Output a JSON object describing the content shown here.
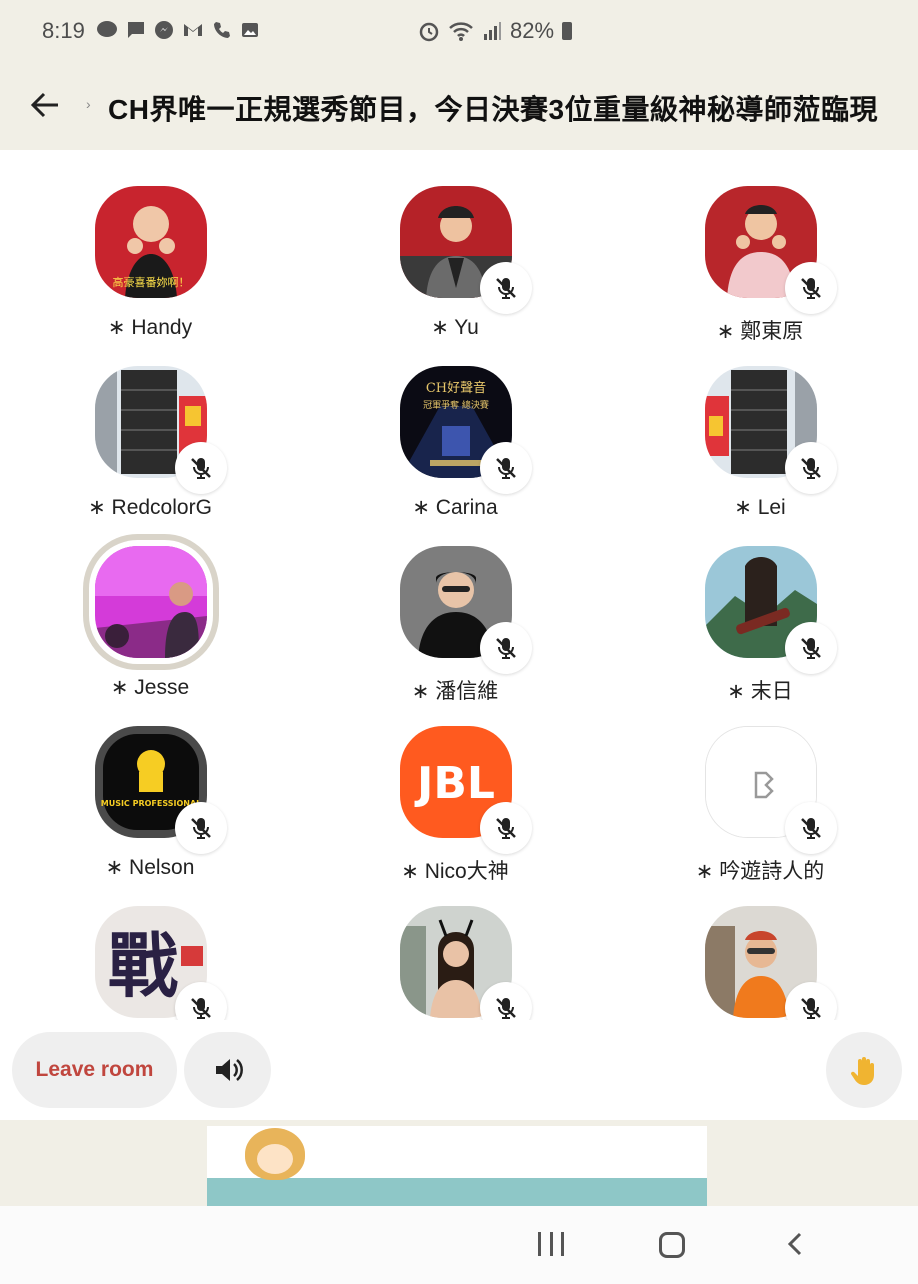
{
  "status_bar": {
    "time": "8:19",
    "left_icons": [
      "line-icon",
      "message-icon",
      "messenger-icon",
      "gmail-icon",
      "call-icon",
      "image-icon"
    ],
    "right_icons": [
      "alarm-icon",
      "wifi-icon",
      "signal-icon"
    ],
    "battery": "82%"
  },
  "header": {
    "title": "CH界唯一正規選秀節目，今日決賽3位重量級神秘導師蒞臨現"
  },
  "members": [
    {
      "name": "Handy",
      "muted": false,
      "speaking": false
    },
    {
      "name": "Yu",
      "muted": true,
      "speaking": false
    },
    {
      "name": "鄭東原",
      "muted": true,
      "speaking": false
    },
    {
      "name": "RedcolorG",
      "muted": true,
      "speaking": false
    },
    {
      "name": "Carina",
      "muted": true,
      "speaking": false
    },
    {
      "name": "Lei",
      "muted": true,
      "speaking": false
    },
    {
      "name": "Jesse",
      "muted": false,
      "speaking": true
    },
    {
      "name": "潘信維",
      "muted": true,
      "speaking": false
    },
    {
      "name": "末日",
      "muted": true,
      "speaking": false
    },
    {
      "name": "Nelson",
      "muted": true,
      "speaking": false
    },
    {
      "name": "Nico大神",
      "muted": true,
      "speaking": false
    },
    {
      "name": "吟遊詩人的",
      "muted": true,
      "speaking": false
    },
    {
      "name": "",
      "muted": true,
      "speaking": false
    },
    {
      "name": "",
      "muted": true,
      "speaking": false
    },
    {
      "name": "",
      "muted": true,
      "speaking": false
    }
  ],
  "name_prefix": "∗",
  "avatar_images": {
    "handy_caption": "高豪喜番妳啊！",
    "carina_line1": "CH好聲音",
    "carina_line2": "冠軍爭奪 總決賽",
    "nelson_logo": "MUSIC PROFESSIONAL",
    "nico_logo": "JBL",
    "row5_left": "戰"
  },
  "controls": {
    "leave_label": "Leave room",
    "speaker_icon": "speaker-icon",
    "hand_icon": "raise-hand-icon"
  },
  "colors": {
    "header_bg": "#f1efe6",
    "leave_text": "#c0463e",
    "button_bg": "#efefef",
    "hand": "#e5a520"
  }
}
